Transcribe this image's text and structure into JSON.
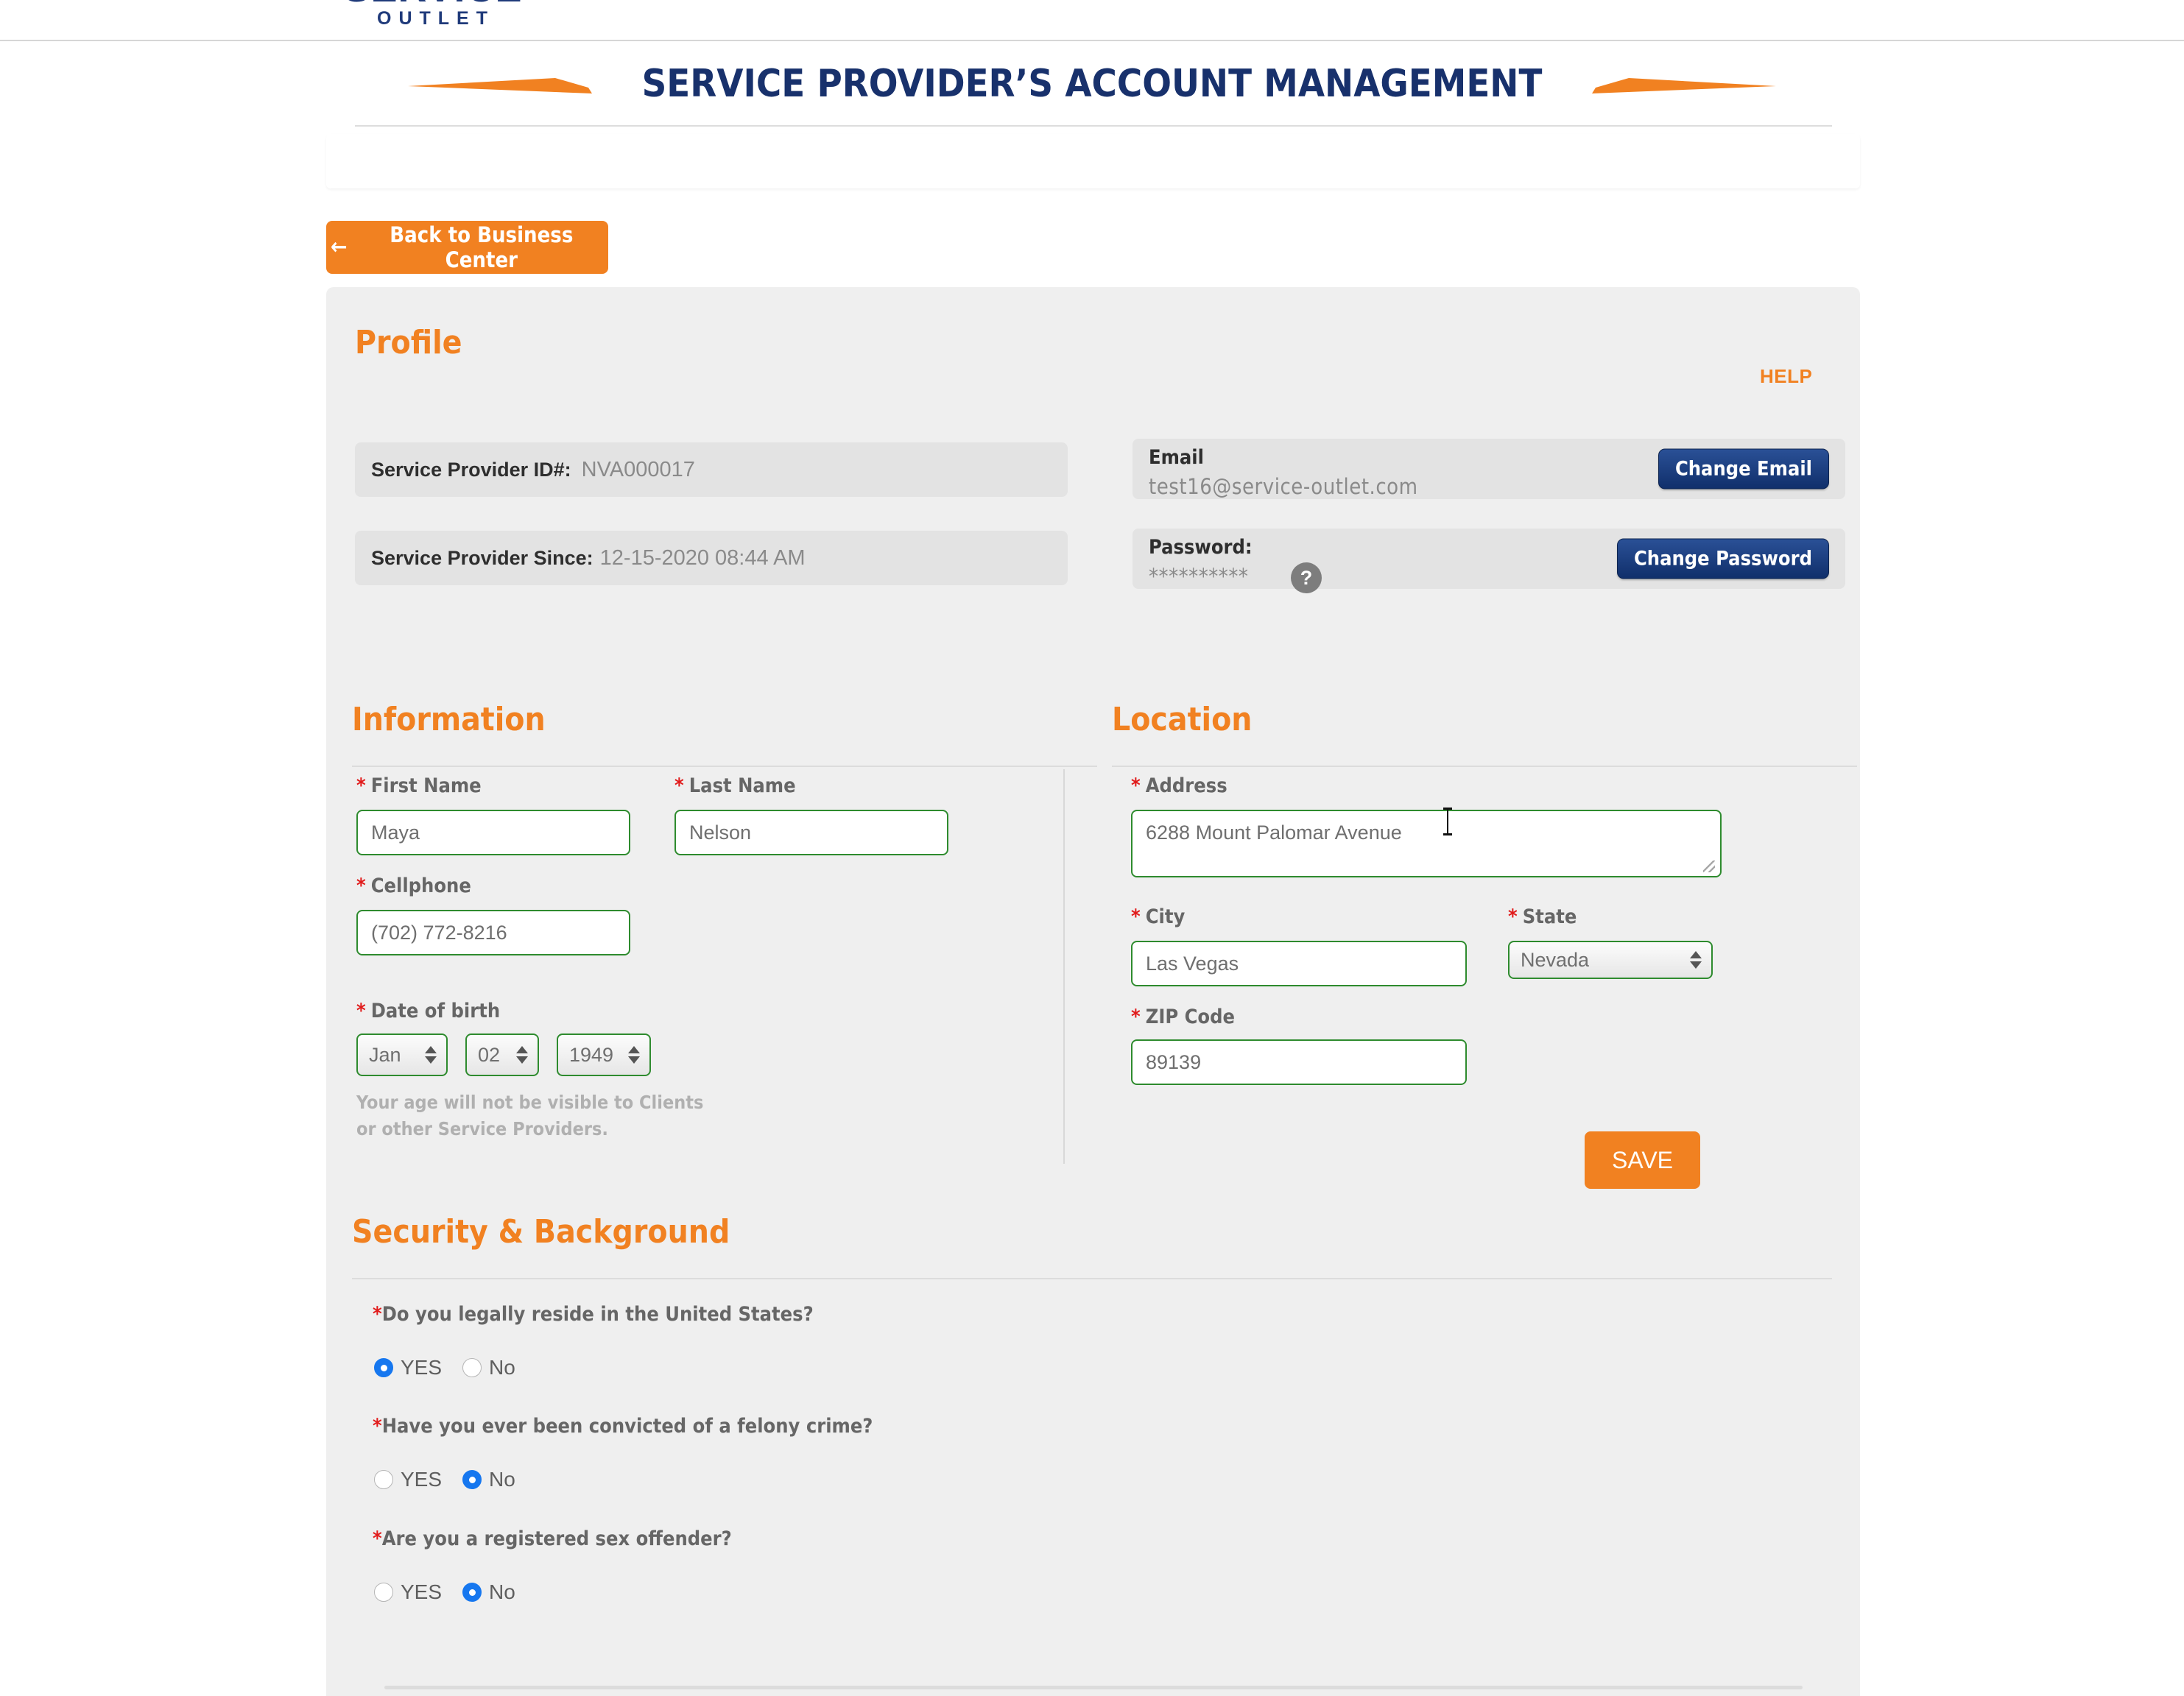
{
  "brand": {
    "logo_main": "SERVICE",
    "logo_sub": "OUTLET"
  },
  "header": {
    "page_title": "SERVICE PROVIDER’S ACCOUNT MANAGEMENT"
  },
  "nav": {
    "back_label": "Back to Business Center",
    "back_icon": "arrow-left-icon"
  },
  "profile": {
    "title": "Profile",
    "help_label": "HELP",
    "service_provider_id_label": "Service Provider ID#:",
    "service_provider_id_value": "NVA000017",
    "since_label": "Service Provider Since:",
    "since_value": "12-15-2020 08:44 AM",
    "email_label": "Email",
    "email_value": "test16@service-outlet.com",
    "change_email_label": "Change Email",
    "password_label": "Password:",
    "password_value": "**********",
    "password_help_icon": "question-mark-icon",
    "change_password_label": "Change Password"
  },
  "information": {
    "title": "Information",
    "first_name_label": "First Name",
    "first_name_value": "Maya",
    "last_name_label": "Last Name",
    "last_name_value": "Nelson",
    "cellphone_label": "Cellphone",
    "cellphone_value": "(702) 772-8216",
    "dob_label": "Date of birth",
    "dob_month": "Jan",
    "dob_day": "02",
    "dob_year": "1949",
    "age_hint_line1": "Your age will not be visible to Clients",
    "age_hint_line2": "or other Service Providers."
  },
  "location": {
    "title": "Location",
    "address_label": "Address",
    "address_value": "6288 Mount Palomar Avenue",
    "city_label": "City",
    "city_value": "Las Vegas",
    "state_label": "State",
    "state_value": "Nevada",
    "zip_label": "ZIP Code",
    "zip_value": "89139",
    "save_label": "SAVE"
  },
  "security": {
    "title": "Security & Background",
    "required_marker": "*",
    "questions": [
      {
        "text": "Do you legally reside in the United States?",
        "yes_label": "YES",
        "no_label": "No",
        "selected": "yes"
      },
      {
        "text": "Have you ever been convicted of a felony crime?",
        "yes_label": "YES",
        "no_label": "No",
        "selected": "no"
      },
      {
        "text": "Are you a registered sex offender?",
        "yes_label": "YES",
        "no_label": "No",
        "selected": "no"
      }
    ]
  },
  "colors": {
    "brand_orange": "#f18121",
    "brand_navy": "#18316c",
    "panel_bg": "#efefef",
    "field_border_valid": "#2e8b2e",
    "required_red": "#e11b1b",
    "radio_selected": "#1677ef"
  }
}
